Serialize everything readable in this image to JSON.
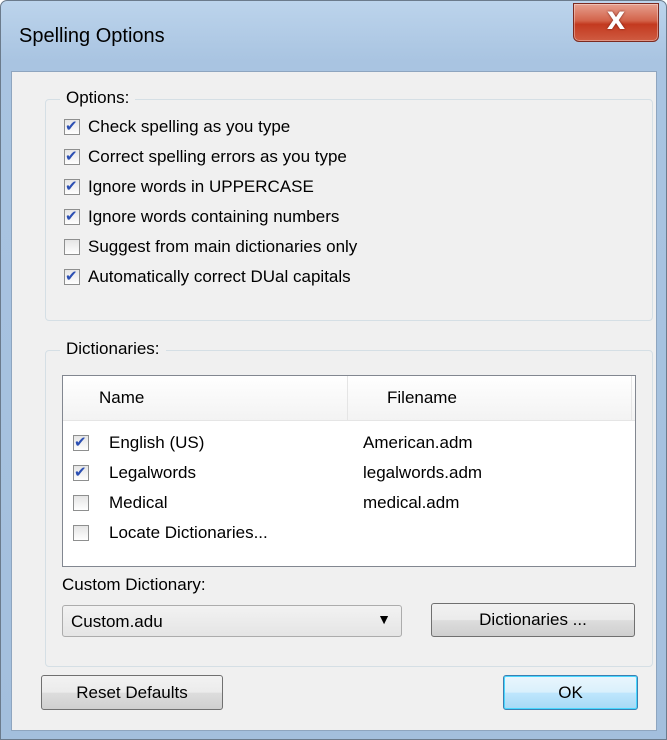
{
  "window": {
    "title": "Spelling Options",
    "close_glyph": "X"
  },
  "options_group": {
    "title": "Options:",
    "items": [
      {
        "label": "Check spelling as you type",
        "checked": true
      },
      {
        "label": "Correct spelling errors as you type",
        "checked": true
      },
      {
        "label": "Ignore words in UPPERCASE",
        "checked": true
      },
      {
        "label": "Ignore words containing numbers",
        "checked": true
      },
      {
        "label": "Suggest from main dictionaries only",
        "checked": false
      },
      {
        "label": "Automatically correct DUal capitals",
        "checked": true
      }
    ]
  },
  "dictionaries_group": {
    "title": "Dictionaries:",
    "columns": {
      "name": "Name",
      "filename": "Filename"
    },
    "rows": [
      {
        "name": "English (US)",
        "filename": "American.adm",
        "checked": true
      },
      {
        "name": "Legalwords",
        "filename": "legalwords.adm",
        "checked": true
      },
      {
        "name": "Medical",
        "filename": "medical.adm",
        "checked": false
      },
      {
        "name": "Locate Dictionaries...",
        "filename": "",
        "checked": false
      }
    ],
    "custom_dictionary_label": "Custom Dictionary:",
    "custom_dictionary_value": "Custom.adu",
    "dictionaries_button": "Dictionaries ..."
  },
  "footer": {
    "reset_button": "Reset Defaults",
    "ok_button": "OK"
  },
  "colors": {
    "frame": "#a9c4e1",
    "close_button": "#c3391f",
    "checkmark": "#2c4fb3"
  }
}
